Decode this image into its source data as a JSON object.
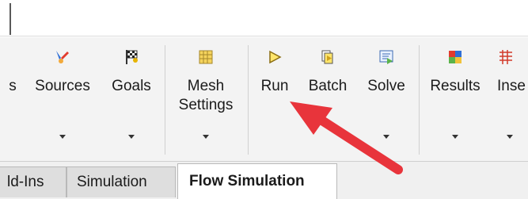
{
  "ribbon": {
    "buttons": [
      {
        "id": "partial",
        "label": "s",
        "icon": "partial-icon"
      },
      {
        "id": "sources",
        "label": "Sources",
        "icon": "sources-icon"
      },
      {
        "id": "goals",
        "label": "Goals",
        "icon": "goals-flag-icon"
      },
      {
        "id": "mesh",
        "label": "Mesh\nSettings",
        "icon": "mesh-settings-icon"
      },
      {
        "id": "run",
        "label": "Run",
        "icon": "run-triangle-icon"
      },
      {
        "id": "batch",
        "label": "Batch",
        "icon": "batch-icon"
      },
      {
        "id": "solve",
        "label": "Solve",
        "icon": "solve-icon"
      },
      {
        "id": "results",
        "label": "Results",
        "icon": "results-icon"
      },
      {
        "id": "insert",
        "label": "Inse",
        "icon": "insert-icon"
      }
    ]
  },
  "tabs": [
    {
      "label": "ld-Ins",
      "active": false
    },
    {
      "label": "Simulation",
      "active": false
    },
    {
      "label": "Flow Simulation",
      "active": true
    }
  ],
  "colors": {
    "arrow": "#e8343b",
    "ribbon_bg": "#f3f3f3",
    "run_icon": "#c9a227",
    "goals_icon": "#d4a017"
  }
}
